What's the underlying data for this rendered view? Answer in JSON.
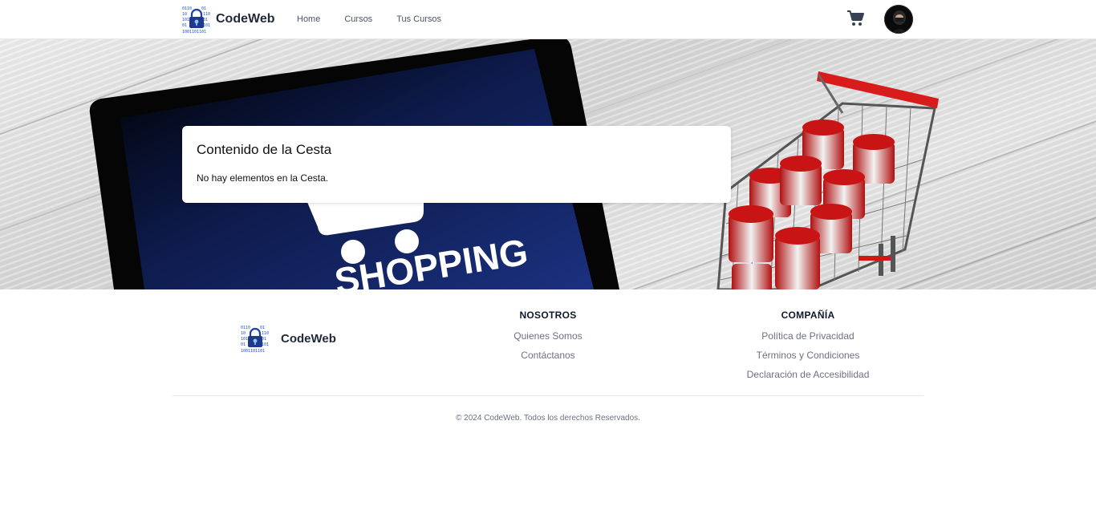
{
  "nav": {
    "brand": "CodeWeb",
    "links": [
      "Home",
      "Cursos",
      "Tus Cursos"
    ],
    "cart_icon": "shopping-cart-icon",
    "avatar_icon": "user-avatar"
  },
  "hero": {
    "image_text": "SHOPPING"
  },
  "cart": {
    "title": "Contenido de la Cesta",
    "empty_message": "No hay elementos en la Cesta."
  },
  "footer": {
    "brand": "CodeWeb",
    "columns": [
      {
        "heading": "NOSOTROS",
        "links": [
          "Quienes Somos",
          "Contáctanos"
        ]
      },
      {
        "heading": "COMPAÑÍA",
        "links": [
          "Política de Privacidad",
          "Términos y Condiciones",
          "Declaración de Accesibilidad"
        ]
      }
    ],
    "copyright": "© 2024 CodeWeb. Todos los derechos Reservados."
  },
  "colors": {
    "brand_blue": "#2563eb",
    "text_dark": "#111827",
    "text_muted": "#6b7280",
    "tablet_blue": "#13266b",
    "cart_red": "#d81b1b"
  }
}
